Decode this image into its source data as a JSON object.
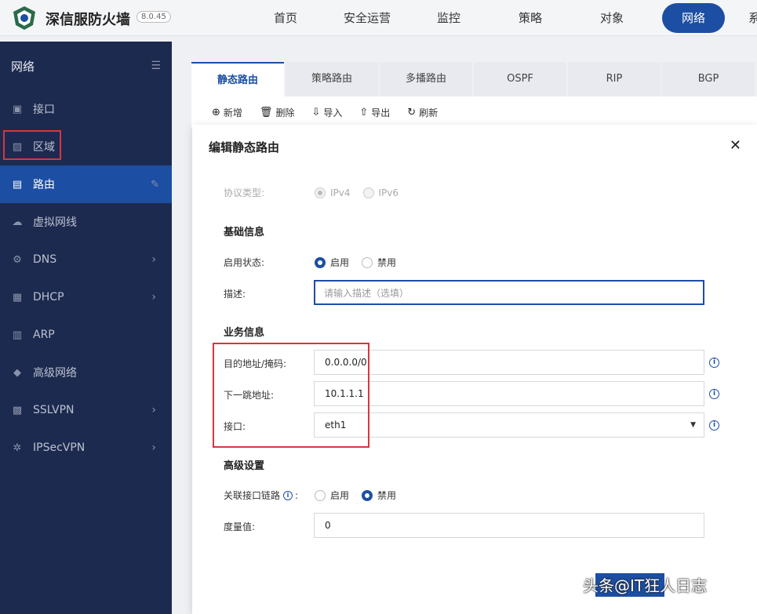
{
  "app": {
    "name": "深信服防火墙",
    "version": "8.0.45"
  },
  "topnav": [
    "首页",
    "安全运营",
    "监控",
    "策略",
    "对象",
    "网络",
    "系"
  ],
  "sidebar": {
    "title": "网络",
    "items": [
      {
        "label": "接口",
        "icon": "interface-icon"
      },
      {
        "label": "区域",
        "icon": "zone-icon"
      },
      {
        "label": "路由",
        "icon": "router-icon"
      },
      {
        "label": "虚拟网线",
        "icon": "virtual-wire-icon"
      },
      {
        "label": "DNS",
        "icon": "dns-icon"
      },
      {
        "label": "DHCP",
        "icon": "dhcp-icon"
      },
      {
        "label": "ARP",
        "icon": "arp-icon"
      },
      {
        "label": "高级网络",
        "icon": "diamond-icon"
      },
      {
        "label": "SSLVPN",
        "icon": "sslvpn-icon"
      },
      {
        "label": "IPSecVPN",
        "icon": "ipsecvpn-icon"
      }
    ]
  },
  "tabs": [
    "静态路由",
    "策略路由",
    "多播路由",
    "OSPF",
    "RIP",
    "BGP"
  ],
  "toolbar": {
    "add": "新增",
    "delete": "删除",
    "import": "导入",
    "export": "导出",
    "refresh": "刷新"
  },
  "modal": {
    "title": "编辑静态路由",
    "protocol_label": "协议类型:",
    "protocol_ipv4": "IPv4",
    "protocol_ipv6": "IPv6",
    "basic_section": "基础信息",
    "status_label": "启用状态:",
    "enable": "启用",
    "disable": "禁用",
    "desc_label": "描述:",
    "desc_placeholder": "请输入描述（选填）",
    "business_section": "业务信息",
    "dest_label": "目的地址/掩码:",
    "dest_value": "0.0.0.0/0",
    "nexthop_label": "下一跳地址:",
    "nexthop_value": "10.1.1.1",
    "iface_label": "接口:",
    "iface_value": "eth1",
    "advanced_section": "高级设置",
    "link_label": "关联接口链路",
    "metric_label": "度量值:",
    "metric_value": "0"
  },
  "watermark": "头条@IT狂人日志",
  "colors": {
    "primary": "#1c4ea3",
    "sidebar": "#1d2a4f",
    "highlight": "#d8353f"
  }
}
